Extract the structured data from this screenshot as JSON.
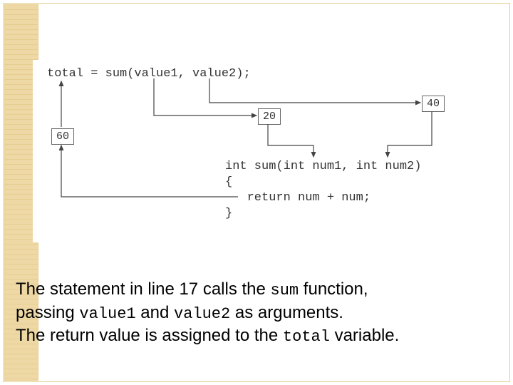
{
  "code": {
    "call_line": "total = sum(value1, value2);",
    "fn_sig": "int sum(int num1, int num2)",
    "brace_open": "{",
    "return_line": "   return num + num;",
    "brace_close": "}"
  },
  "values": {
    "arg1": "20",
    "arg2": "40",
    "result": "60"
  },
  "caption": {
    "s1a": "The statement in line 17 calls the ",
    "s1b": "sum",
    "s1c": " function,",
    "s2a": "passing ",
    "s2b": "value1",
    "s2c": " and ",
    "s2d": "value2",
    "s2e": " as arguments.",
    "s3a": "The return value is assigned to the ",
    "s3b": "total",
    "s3c": " variable."
  }
}
